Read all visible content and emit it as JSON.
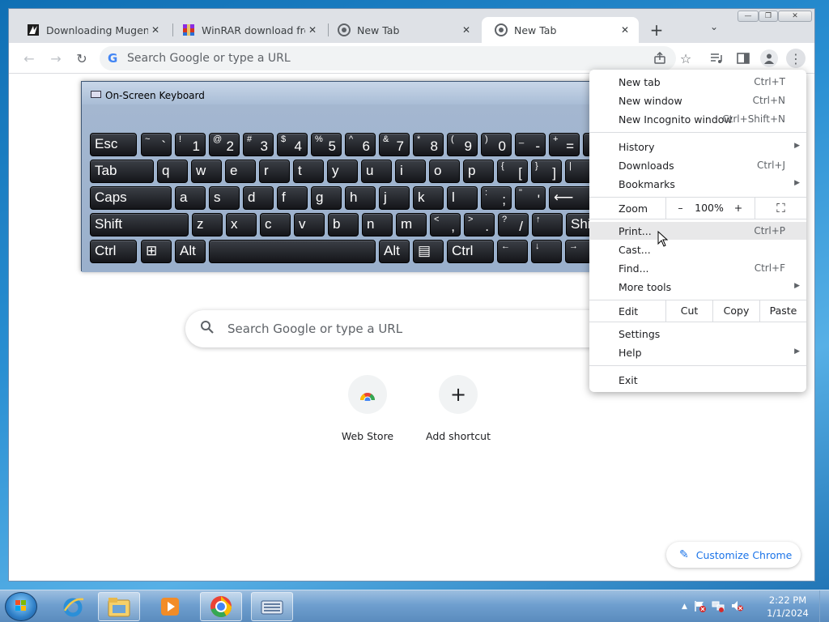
{
  "browser": {
    "tabs": [
      {
        "title": "Downloading Mugen - C",
        "icon": "mugen-icon",
        "close": "✕"
      },
      {
        "title": "WinRAR download free",
        "icon": "winrar-icon",
        "close": "✕"
      },
      {
        "title": "New Tab",
        "icon": "chrome-icon",
        "close": "✕"
      },
      {
        "title": "New Tab",
        "icon": "chrome-icon",
        "close": "✕"
      }
    ],
    "new_tab_glyph": "+",
    "tab_list_glyph": "⌄",
    "window_controls": {
      "minimize": "—",
      "restore": "❐",
      "close": "✕"
    },
    "omnibox": {
      "g_logo": "G",
      "placeholder": "Search Google or type a URL"
    }
  },
  "ntp": {
    "search_placeholder": "Search Google or type a URL",
    "shortcuts": [
      {
        "label": "Web Store",
        "icon": "web-store-icon"
      },
      {
        "label": "Add shortcut",
        "icon": "plus-icon",
        "glyph": "+"
      }
    ],
    "customize_label": "Customize Chrome",
    "customize_icon": "✎"
  },
  "osk": {
    "title": "On-Screen Keyboard",
    "rows": [
      [
        {
          "m": "Esc"
        },
        {
          "s": "~",
          "b": "`"
        },
        {
          "s": "!",
          "b": "1"
        },
        {
          "s": "@",
          "b": "2"
        },
        {
          "s": "#",
          "b": "3"
        },
        {
          "s": "$",
          "b": "4"
        },
        {
          "s": "%",
          "b": "5"
        },
        {
          "s": "^",
          "b": "6"
        },
        {
          "s": "&",
          "b": "7"
        },
        {
          "s": "*",
          "b": "8"
        },
        {
          "s": "(",
          "b": "9"
        },
        {
          "s": ")",
          "b": "0"
        },
        {
          "s": "_",
          "b": "-"
        },
        {
          "s": "+",
          "b": "="
        },
        {
          "m": ""
        }
      ],
      [
        {
          "m": "Tab"
        },
        {
          "m": "q"
        },
        {
          "m": "w"
        },
        {
          "m": "e"
        },
        {
          "m": "r"
        },
        {
          "m": "t"
        },
        {
          "m": "y"
        },
        {
          "m": "u"
        },
        {
          "m": "i"
        },
        {
          "m": "o"
        },
        {
          "m": "p"
        },
        {
          "s": "{",
          "b": "["
        },
        {
          "s": "}",
          "b": "]"
        },
        {
          "s": "|",
          "b": "\\"
        }
      ],
      [
        {
          "m": "Caps"
        },
        {
          "m": "a"
        },
        {
          "m": "s"
        },
        {
          "m": "d"
        },
        {
          "m": "f"
        },
        {
          "m": "g"
        },
        {
          "m": "h"
        },
        {
          "m": "j"
        },
        {
          "m": "k"
        },
        {
          "m": "l"
        },
        {
          "s": ":",
          "b": ";"
        },
        {
          "s": "\"",
          "b": "'"
        },
        {
          "m": "⟵"
        }
      ],
      [
        {
          "m": "Shift"
        },
        {
          "m": "z"
        },
        {
          "m": "x"
        },
        {
          "m": "c"
        },
        {
          "m": "v"
        },
        {
          "m": "b"
        },
        {
          "m": "n"
        },
        {
          "m": "m"
        },
        {
          "s": "<",
          "b": ","
        },
        {
          "s": ">",
          "b": "."
        },
        {
          "s": "?",
          "b": "/"
        },
        {
          "s": "↑",
          "b": ""
        },
        {
          "m": "Shi"
        }
      ],
      [
        {
          "m": "Ctrl"
        },
        {
          "m": "⊞"
        },
        {
          "m": "Alt"
        },
        {
          "m": ""
        },
        {
          "m": "Alt"
        },
        {
          "m": "▤"
        },
        {
          "m": "Ctrl"
        },
        {
          "s": "←",
          "b": ""
        },
        {
          "s": "↓",
          "b": ""
        },
        {
          "s": "→",
          "b": ""
        }
      ]
    ]
  },
  "menu": {
    "group1": [
      {
        "label": "New tab",
        "shortcut": "Ctrl+T"
      },
      {
        "label": "New window",
        "shortcut": "Ctrl+N"
      },
      {
        "label": "New Incognito window",
        "shortcut": "Ctrl+Shift+N"
      }
    ],
    "group2": [
      {
        "label": "History",
        "arrow": "▶"
      },
      {
        "label": "Downloads",
        "shortcut": "Ctrl+J"
      },
      {
        "label": "Bookmarks",
        "arrow": "▶"
      }
    ],
    "zoom": {
      "label": "Zoom",
      "minus": "–",
      "value": "100%",
      "plus": "+",
      "fullscreen": "⛶"
    },
    "group3": [
      {
        "label": "Print...",
        "shortcut": "Ctrl+P"
      },
      {
        "label": "Cast..."
      },
      {
        "label": "Find...",
        "shortcut": "Ctrl+F"
      },
      {
        "label": "More tools",
        "arrow": "▶"
      }
    ],
    "edit": {
      "label": "Edit",
      "cut": "Cut",
      "copy": "Copy",
      "paste": "Paste"
    },
    "group4": [
      {
        "label": "Settings"
      },
      {
        "label": "Help",
        "arrow": "▶"
      }
    ],
    "exit": "Exit"
  },
  "taskbar": {
    "apps": [
      "internet-explorer-icon",
      "file-explorer-icon",
      "media-player-icon",
      "chrome-icon",
      "on-screen-keyboard-icon"
    ],
    "tray_chevron": "▲",
    "time": "2:22 PM",
    "date": "1/1/2024"
  }
}
